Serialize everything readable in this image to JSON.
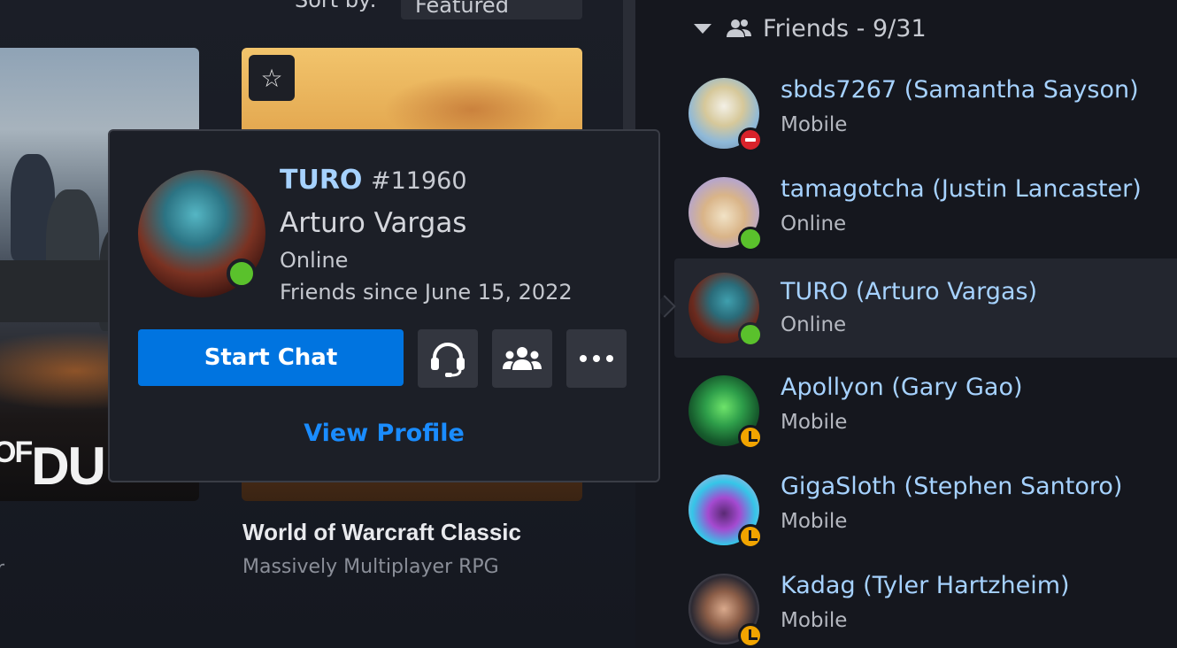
{
  "library": {
    "sort_label": "Sort by:",
    "sort_value": "Featured",
    "cod_title_small": "OF",
    "cod_title_big": "DU",
    "cut_text": "r",
    "wow": {
      "name": "World of Warcraft Classic",
      "genre": "Massively Multiplayer RPG"
    },
    "favorite_icon": "star-icon"
  },
  "friends_panel": {
    "header": "Friends - 9/31",
    "friends": [
      {
        "name": "sbds7267 (Samantha Sayson)",
        "status": "Mobile",
        "presence": "busy"
      },
      {
        "name": "tamagotcha (Justin Lancaster)",
        "status": "Online",
        "presence": "online"
      },
      {
        "name": "TURO (Arturo Vargas)",
        "status": "Online",
        "presence": "online",
        "selected": true
      },
      {
        "name": "Apollyon (Gary Gao)",
        "status": "Mobile",
        "presence": "away"
      },
      {
        "name": "GigaSloth (Stephen Santoro)",
        "status": "Mobile",
        "presence": "away"
      },
      {
        "name": "Kadag (Tyler Hartzheim)",
        "status": "Mobile",
        "presence": "away"
      }
    ]
  },
  "popup": {
    "battletag": "TURO",
    "battletag_number": "#11960",
    "real_name": "Arturo Vargas",
    "status": "Online",
    "friends_since": "Friends since June 15, 2022",
    "start_chat": "Start Chat",
    "view_profile": "View Profile",
    "actions": [
      "headset-icon",
      "group-icon",
      "more-icon"
    ]
  },
  "colors": {
    "accent": "#0074e0",
    "link": "#1a8cff",
    "name": "#a6d2ff",
    "online": "#5ac12c",
    "busy": "#d9232b",
    "away": "#f1a400"
  }
}
